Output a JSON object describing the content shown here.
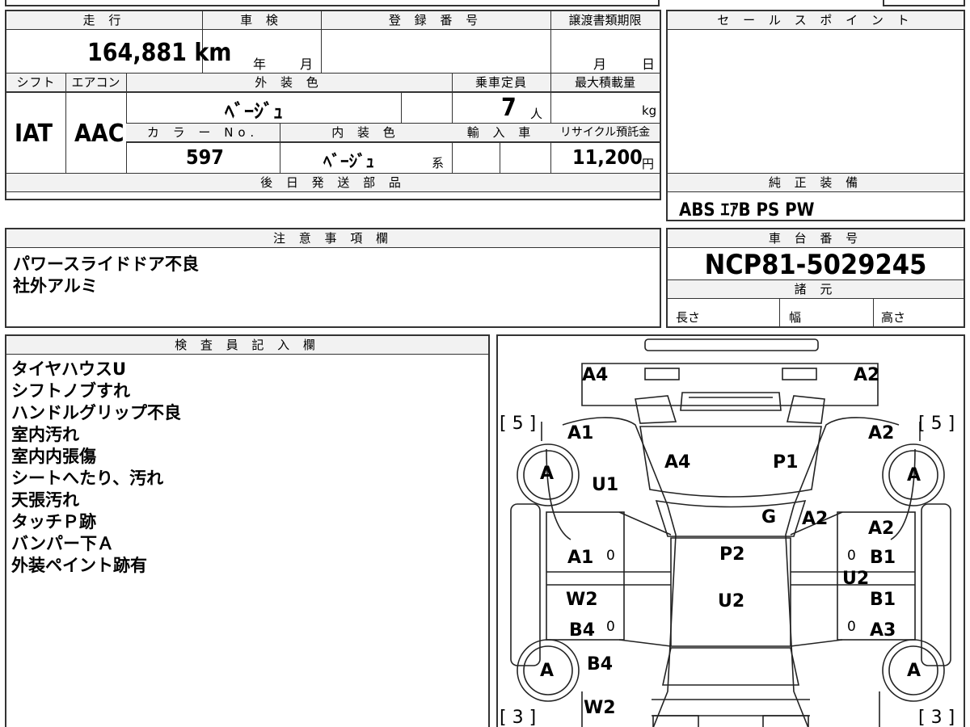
{
  "mileage": {
    "header": "走 行",
    "value": "164,881 km"
  },
  "shaken": {
    "header": "車 検",
    "year_unit": "年",
    "month_unit": "月"
  },
  "registration": {
    "header": "登 録 番 号"
  },
  "transfer_deadline": {
    "header": "譲渡書類期限",
    "month_unit": "月",
    "day_unit": "日"
  },
  "sale_points": {
    "header": "セ ー ル ス ポ イ ン ト"
  },
  "shift": {
    "header": "シフト",
    "value": "IAT"
  },
  "aircon": {
    "header": "エアコン",
    "value": "AAC"
  },
  "exterior_color": {
    "header": "外 装 色",
    "value": "ﾍﾞｰｼﾞｭ"
  },
  "capacity": {
    "header": "乗車定員",
    "value": "7",
    "unit": "人"
  },
  "max_load": {
    "header": "最大積載量",
    "unit": "kg"
  },
  "color_no": {
    "header": "カ ラ ー No.",
    "value": "597"
  },
  "interior_color": {
    "header": "内 装 色",
    "value": "ﾍﾞｰｼﾞｭ",
    "suffix": "系"
  },
  "import": {
    "header": "輸 入 車"
  },
  "recycle": {
    "header": "リサイクル預託金",
    "value": "11,200",
    "unit": "円"
  },
  "later_parts": {
    "header": "後 日 発 送 部 品"
  },
  "genuine_equipment": {
    "header": "純 正 装 備",
    "value": "ABS ｴｱB PS PW"
  },
  "caution": {
    "header": "注 意 事 項 欄",
    "lines": [
      "パワースライドドア不良",
      "社外アルミ"
    ]
  },
  "chassis": {
    "header": "車 台 番 号",
    "value": "NCP81-5029245"
  },
  "specs": {
    "header": "諸 元",
    "length": "長さ",
    "width": "幅",
    "height": "高さ"
  },
  "inspector": {
    "header": "検 査 員 記 入 欄",
    "lines": [
      "タイヤハウスU",
      "シフトノブすれ",
      "ハンドルグリップ不良",
      "室内汚れ",
      "室内内張傷",
      "シートへたり、汚れ",
      "天張汚れ",
      "タッチＰ跡",
      "バンパー下Ａ",
      "外装ペイント跡有"
    ]
  },
  "diagram": {
    "tire_left_front": "[ 5 ]",
    "tire_right_front": "[ 5 ]",
    "tire_left_rear": "[ 3 ]",
    "tire_right_rear": "[ 3 ]",
    "wheel_mark": "A",
    "labels": {
      "a4_top": "A4",
      "a2_top": "A2",
      "a1_lf": "A1",
      "a2_rf": "A2",
      "a4_hood": "A4",
      "p1_hood": "P1",
      "u1": "U1",
      "g": "G",
      "a2_ws": "A2",
      "a2_rd": "A2",
      "p2": "P2",
      "a1_ld": "A1",
      "b1_r1": "B1",
      "u2_r": "U2",
      "w2_l": "W2",
      "u2_roof": "U2",
      "b1_r2": "B1",
      "b4_l": "B4",
      "a3_r": "A3",
      "b4_lr": "B4",
      "w2_lr": "W2",
      "zero": "0"
    }
  }
}
